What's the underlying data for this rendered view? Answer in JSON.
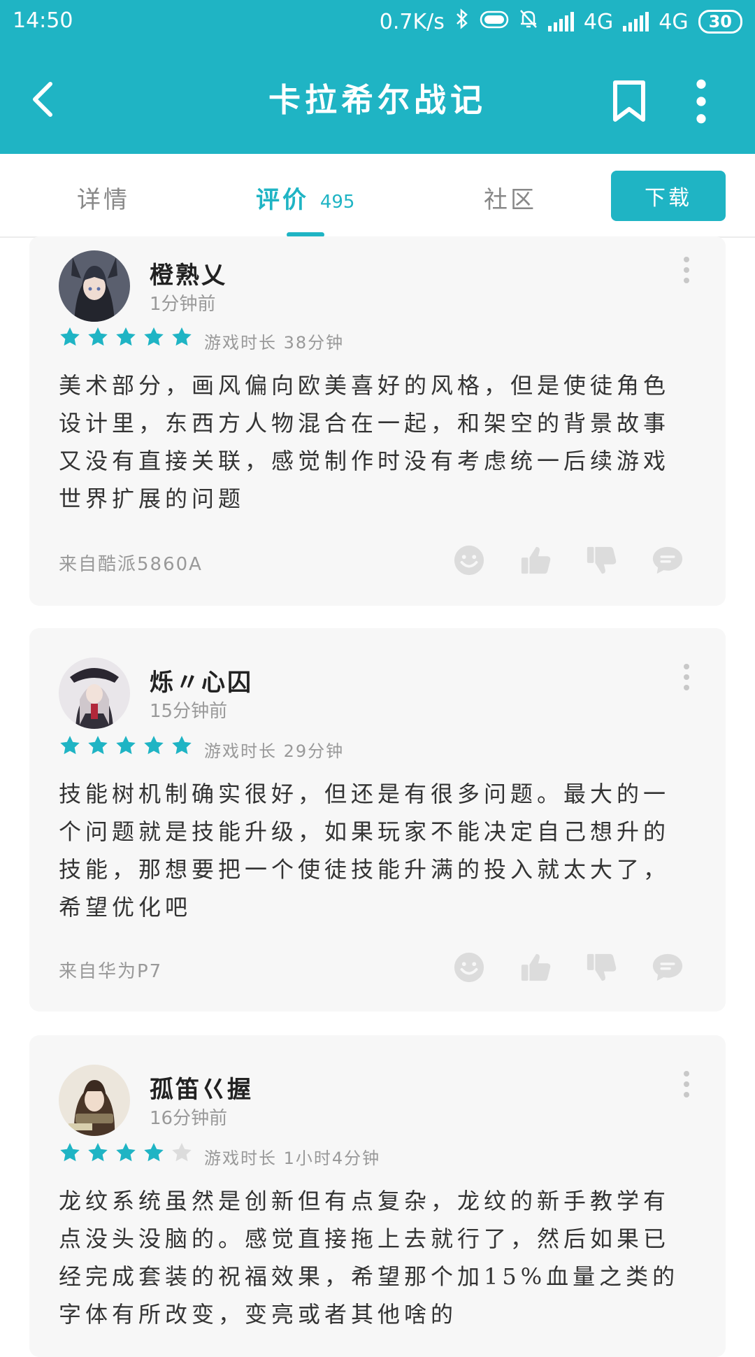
{
  "status_bar": {
    "time": "14:50",
    "net_speed": "0.7K/s",
    "network1": "4G",
    "network2": "4G",
    "battery": "30"
  },
  "app_bar": {
    "title": "卡拉希尔战记",
    "icons": [
      "back-arrow-icon",
      "bookmark-icon",
      "more-vertical-icon"
    ]
  },
  "tabs": {
    "details": "详情",
    "reviews": "评价",
    "reviews_count": "495",
    "community": "社区",
    "download": "下载",
    "active": "reviews"
  },
  "colors": {
    "accent": "#1fb4c4",
    "star_empty": "#dcdcdc"
  },
  "reviews": [
    {
      "username": "橙熟乂",
      "time": "1分钟前",
      "rating": 5,
      "playtime": "游戏时长 38分钟",
      "text": "美术部分，画风偏向欧美喜好的风格，但是使徒角色设计里，东西方人物混合在一起，和架空的背景故事又没有直接关联，感觉制作时没有考虑统一后续游戏世界扩展的问题",
      "device": "来自酷派5860A"
    },
    {
      "username": "烁〃心囚",
      "time": "15分钟前",
      "rating": 5,
      "playtime": "游戏时长 29分钟",
      "text": "技能树机制确实很好，但还是有很多问题。最大的一个问题就是技能升级，如果玩家不能决定自己想升的技能，那想要把一个使徒技能升满的投入就太大了，希望优化吧",
      "device": "来自华为P7"
    },
    {
      "username": "孤笛巜握",
      "time": "16分钟前",
      "rating": 4,
      "playtime": "游戏时长 1小时4分钟",
      "text": "龙纹系统虽然是创新但有点复杂，龙纹的新手教学有点没头没脑的。感觉直接拖上去就行了，然后如果已经完成套装的祝福效果，希望那个加15%血量之类的字体有所改变，变亮或者其他啥的",
      "device": ""
    }
  ]
}
